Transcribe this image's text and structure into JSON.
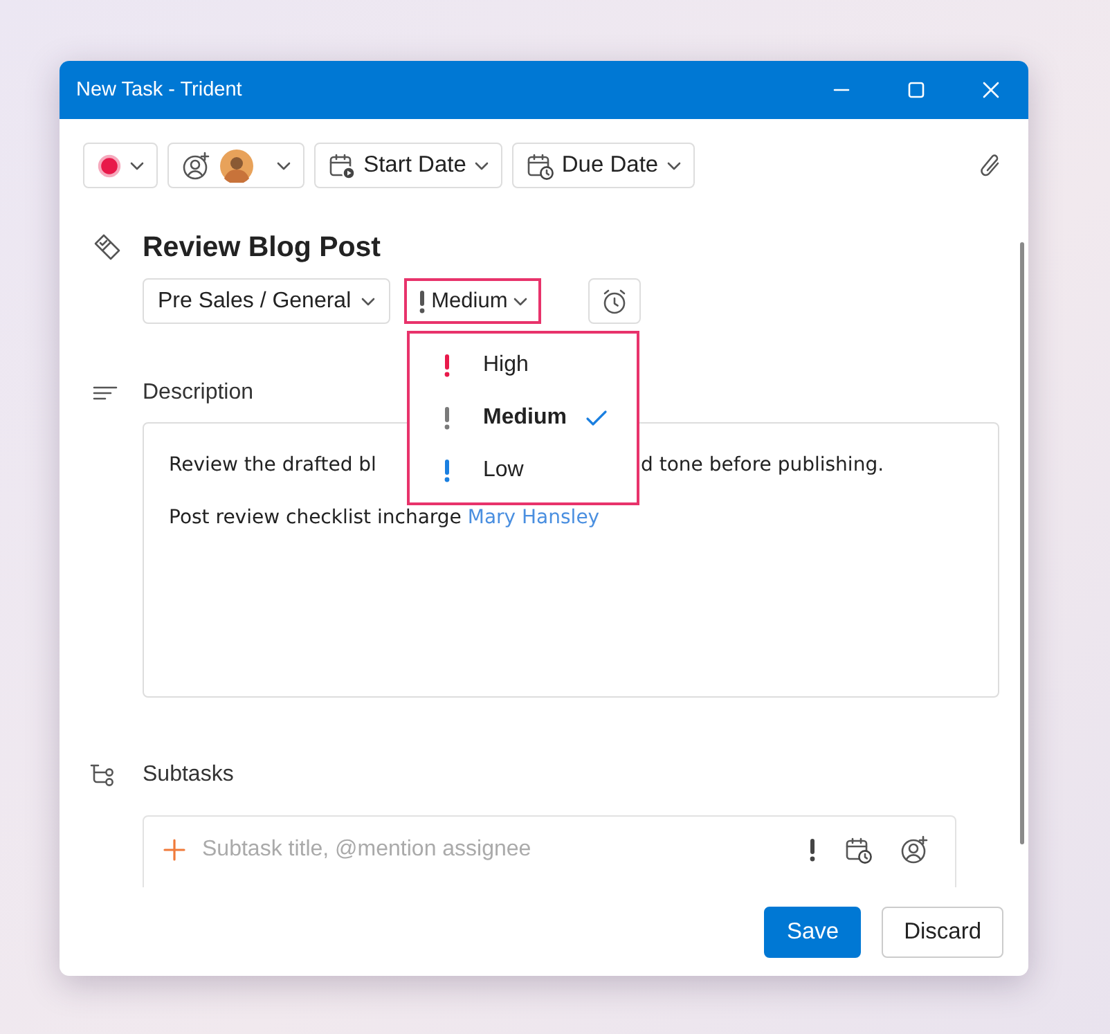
{
  "window": {
    "title": "New Task - Trident"
  },
  "toolbar": {
    "start_date": "Start Date",
    "due_date": "Due Date"
  },
  "task": {
    "title": "Review Blog Post",
    "category": "Pre Sales / General",
    "priority": "Medium"
  },
  "priority_menu": [
    {
      "label": "High",
      "color": "#e8194a",
      "selected": false
    },
    {
      "label": "Medium",
      "color": "#7a7a7a",
      "selected": true
    },
    {
      "label": "Low",
      "color": "#1a7fe0",
      "selected": false
    }
  ],
  "description": {
    "label": "Description",
    "line_1_start": "Review the drafted bl",
    "line_1_end": "d tone before publishing.",
    "line_2": "Post review checklist incharge",
    "mention": "Mary Hansley"
  },
  "subtasks": {
    "label": "Subtasks",
    "placeholder": "Subtask title, @mention assignee"
  },
  "buttons": [
    {
      "label": "Save",
      "kind": "primary"
    },
    {
      "label": "Discard",
      "kind": "secondary"
    }
  ]
}
